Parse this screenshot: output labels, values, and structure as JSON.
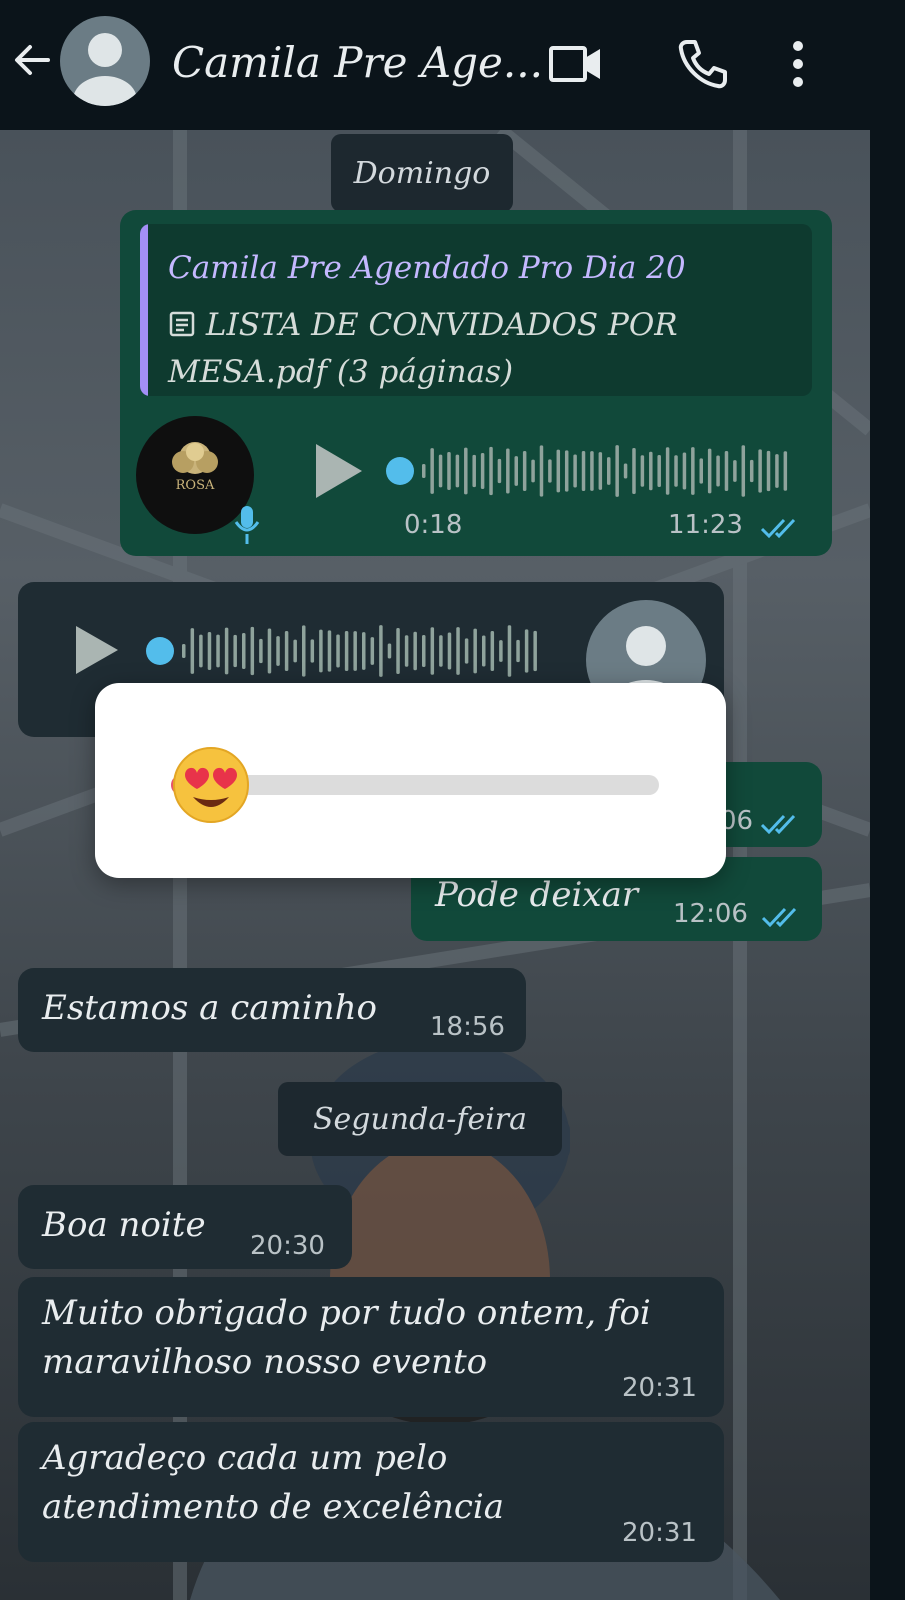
{
  "header": {
    "contact_name": "Camila Pre Age...",
    "icons": [
      "back-arrow-icon",
      "avatar",
      "video-call-icon",
      "phone-icon",
      "more-options-icon"
    ]
  },
  "chat": {
    "day_labels": {
      "top_partial": "Domingo",
      "second": "Segunda-feira"
    },
    "quoted_message": {
      "title": "Camila Pre Agendado Pro Dia 20",
      "doc_line1": "LISTA DE CONVIDADOS POR",
      "doc_line2": "MESA.pdf (3 páginas)",
      "doc_icon": "document-icon"
    },
    "outgoing_audio": {
      "duration": "0:18",
      "time": "11:23",
      "thumbnail_text": "ROSA"
    },
    "incoming_audio": {
      "icon": "play-icon"
    },
    "partial_time": "06",
    "messages": [
      {
        "text": "Pode deixar",
        "time": "12:06",
        "direction": "out"
      },
      {
        "text": "Estamos a caminho",
        "time": "18:56",
        "direction": "in"
      },
      {
        "text": "Boa noite",
        "time": "20:30",
        "direction": "in"
      },
      {
        "text": "Muito obrigado por tudo ontem, foi maravilhoso nosso evento",
        "time": "20:31",
        "direction": "in"
      },
      {
        "text": "Agradeço cada um pelo atendimento de excelência",
        "time": "20:31",
        "direction": "in"
      }
    ]
  },
  "reaction_slider": {
    "emoji": "😍",
    "level": 0.03
  },
  "colors": {
    "outgoing": "#11493a",
    "incoming": "#1f2c33",
    "accent_blue": "#53bdeb",
    "quote_bar": "#a38ff5"
  }
}
